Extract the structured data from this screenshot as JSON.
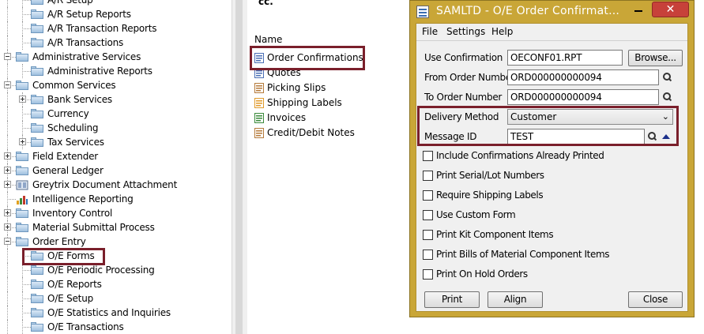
{
  "tree": {
    "items": [
      {
        "label": "A/R Setup",
        "level": 1
      },
      {
        "label": "A/R Setup Reports",
        "level": 1
      },
      {
        "label": "A/R Transaction Reports",
        "level": 1
      },
      {
        "label": "A/R Transactions",
        "level": 1
      },
      {
        "label": "Administrative Services",
        "level": 0,
        "expander": "minus"
      },
      {
        "label": "Administrative Reports",
        "level": 1
      },
      {
        "label": "Common Services",
        "level": 0,
        "expander": "minus"
      },
      {
        "label": "Bank Services",
        "level": 1,
        "expander": "plus"
      },
      {
        "label": "Currency",
        "level": 1
      },
      {
        "label": "Scheduling",
        "level": 1
      },
      {
        "label": "Tax Services",
        "level": 1,
        "expander": "plus"
      },
      {
        "label": "Field Extender",
        "level": 0,
        "expander": "plus"
      },
      {
        "label": "General Ledger",
        "level": 0,
        "expander": "plus"
      },
      {
        "label": "Greytrix Document Attachment",
        "level": 0,
        "expander": "plus",
        "icon": "document-attachment-icon"
      },
      {
        "label": "Intelligence Reporting",
        "level": 0,
        "icon": "intelligence-reporting-icon"
      },
      {
        "label": "Inventory Control",
        "level": 0,
        "expander": "plus"
      },
      {
        "label": "Material Submittal Process",
        "level": 0,
        "expander": "plus"
      },
      {
        "label": "Order Entry",
        "level": 0,
        "expander": "minus"
      },
      {
        "label": "O/E Forms",
        "level": 1,
        "selected": true
      },
      {
        "label": "O/E Periodic Processing",
        "level": 1
      },
      {
        "label": "O/E Reports",
        "level": 1
      },
      {
        "label": "O/E Setup",
        "level": 1
      },
      {
        "label": "O/E Statistics and Inquiries",
        "level": 1
      },
      {
        "label": "O/E Transactions",
        "level": 1
      }
    ]
  },
  "list": {
    "header_fragment": "cc.",
    "column_name": "Name",
    "items": [
      {
        "label": "Order Confirmations",
        "icon": "order-confirmation-icon",
        "color": "#4a6fb5"
      },
      {
        "label": "Quotes",
        "icon": "quote-icon",
        "color": "#4a6fb5"
      },
      {
        "label": "Picking Slips",
        "icon": "picking-slip-icon",
        "color": "#b57a3a"
      },
      {
        "label": "Shipping Labels",
        "icon": "shipping-label-icon",
        "color": "#e09a2a"
      },
      {
        "label": "Invoices",
        "icon": "invoice-icon",
        "color": "#3a8a3a"
      },
      {
        "label": "Credit/Debit Notes",
        "icon": "credit-debit-note-icon",
        "color": "#b57a3a"
      }
    ]
  },
  "dialog": {
    "title": "SAMLTD - O/E Order Confirmat...",
    "close_glyph": "✕",
    "menu": [
      "File",
      "Settings",
      "Help"
    ],
    "use_confirmation": {
      "label": "Use Confirmation",
      "value": "OECONF01.RPT",
      "browse_label": "Browse..."
    },
    "from_order": {
      "label": "From Order Number",
      "value": "ORD000000000094"
    },
    "to_order": {
      "label": "To Order Number",
      "value": "ORD000000000094"
    },
    "delivery_method": {
      "label": "Delivery Method",
      "value": "Customer"
    },
    "message_id": {
      "label": "Message ID",
      "value": "TEST"
    },
    "checkboxes": [
      {
        "label": "Include Confirmations Already Printed",
        "checked": false
      },
      {
        "label": "Print Serial/Lot Numbers",
        "checked": false
      },
      {
        "label": "Require Shipping Labels",
        "checked": false
      },
      {
        "label": "Use Custom Form",
        "checked": false
      },
      {
        "label": "Print Kit Component Items",
        "checked": false
      },
      {
        "label": "Print Bills of Material Component Items",
        "checked": false
      },
      {
        "label": "Print On Hold Orders",
        "checked": false
      }
    ],
    "buttons": {
      "print": "Print",
      "align": "Align",
      "close": "Close"
    }
  },
  "colors": {
    "dialog_frame": "#c9a637",
    "highlight_box": "#7a1f2b",
    "close_button": "#c7413a"
  }
}
